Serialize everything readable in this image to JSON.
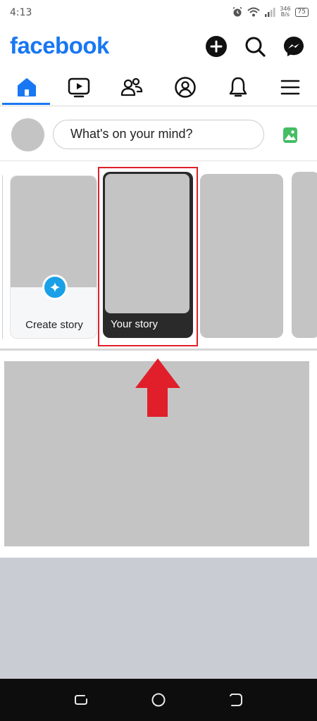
{
  "status_bar": {
    "time": "4:13",
    "net_speed_value": "346",
    "net_speed_unit": "B/s",
    "battery": "75",
    "icons": [
      "alarm-icon",
      "wifi-icon",
      "signal-icon",
      "battery-icon"
    ]
  },
  "header": {
    "logo": "facebook",
    "actions": [
      "add-icon",
      "search-icon",
      "messenger-icon"
    ]
  },
  "tabs": {
    "items": [
      "home-icon",
      "video-icon",
      "friends-icon",
      "profile-icon",
      "notifications-icon",
      "menu-icon"
    ],
    "active": "home-icon"
  },
  "composer": {
    "placeholder": "What's on your mind?",
    "photo_icon": "photo-icon"
  },
  "stories": {
    "create_label": "Create story",
    "your_story_label": "Your story"
  },
  "annotation": {
    "highlight_color": "#e01f2a",
    "arrow": "up-arrow"
  },
  "colors": {
    "brand": "#1877f2",
    "story_plus": "#1aa0e6",
    "placeholder_gray": "#c4c4c4"
  },
  "navbar": {
    "buttons": [
      "recents-icon",
      "home-circle-icon",
      "back-icon"
    ]
  }
}
